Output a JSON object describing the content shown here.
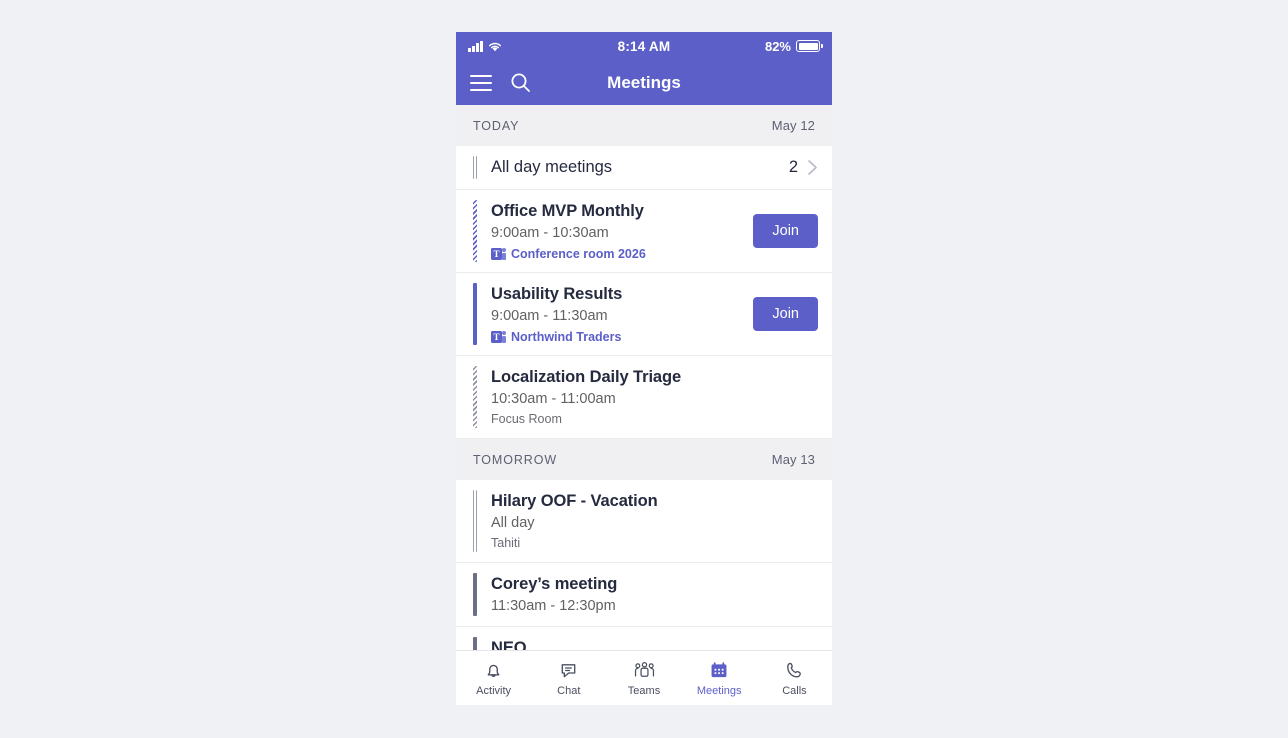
{
  "status_bar": {
    "time": "8:14 AM",
    "battery_percent": "82%",
    "signal_icon": "cellular-signal-icon",
    "wifi_icon": "wifi-icon",
    "battery_icon": "battery-icon"
  },
  "app_bar": {
    "title": "Meetings",
    "menu_icon": "hamburger-menu-icon",
    "search_icon": "search-icon"
  },
  "sections": [
    {
      "label": "TODAY",
      "date": "May 12",
      "rows": [
        {
          "kind": "all_day_summary",
          "title": "All day meetings",
          "count": "2",
          "bar": "double-gray",
          "chevron_icon": "chevron-right-icon"
        },
        {
          "kind": "meeting",
          "title": "Office MVP Monthly",
          "time": "9:00am - 10:30am",
          "channel": "Conference room 2026",
          "channel_icon": "teams-logo-icon",
          "bar": "hatch-purple",
          "join_label": "Join"
        },
        {
          "kind": "meeting",
          "title": "Usability Results",
          "time": "9:00am - 11:30am",
          "channel": "Northwind Traders",
          "channel_icon": "teams-logo-icon",
          "bar": "solid-purple",
          "join_label": "Join"
        },
        {
          "kind": "meeting",
          "title": "Localization Daily Triage",
          "time": "10:30am - 11:00am",
          "location": "Focus Room",
          "bar": "hatch-gray"
        }
      ]
    },
    {
      "label": "TOMORROW",
      "date": "May 13",
      "rows": [
        {
          "kind": "meeting",
          "title": "Hilary OOF - Vacation",
          "time": "All day",
          "location": "Tahiti",
          "bar": "double-gray"
        },
        {
          "kind": "meeting",
          "title": "Corey’s meeting",
          "time": "11:30am - 12:30pm",
          "bar": "solid-gray"
        },
        {
          "kind": "meeting",
          "title": "NEO",
          "bar": "solid-gray"
        }
      ]
    }
  ],
  "tab_bar": {
    "tabs": [
      {
        "label": "Activity",
        "icon": "bell-icon",
        "active": false
      },
      {
        "label": "Chat",
        "icon": "chat-bubble-icon",
        "active": false
      },
      {
        "label": "Teams",
        "icon": "people-group-icon",
        "active": false
      },
      {
        "label": "Meetings",
        "icon": "calendar-icon",
        "active": true
      },
      {
        "label": "Calls",
        "icon": "phone-icon",
        "active": false
      }
    ]
  },
  "colors": {
    "brand_purple": "#5b5fc7",
    "section_bg": "#f0f0f2",
    "title_text": "#252a3f",
    "secondary_text": "#616161",
    "page_bg": "#f0f1f5"
  }
}
